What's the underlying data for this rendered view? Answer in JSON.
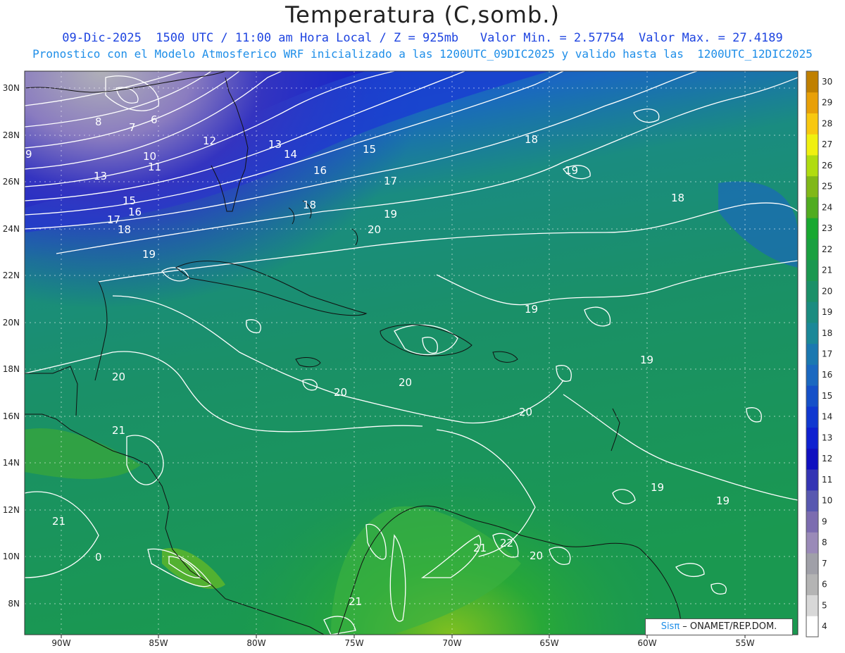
{
  "title": "Temperatura (C,somb.)",
  "subtitle_line1": "09-Dic-2025  1500 UTC / 11:00 am Hora Local / Z = 925mb   Valor Min. = 2.57754  Valor Max. = 27.4189",
  "subtitle_line2": "Pronostico con el Modelo Atmosferico WRF inicializado a las 1200UTC_09DIC2025 y valido hasta las  1200UTC_12DIC2025",
  "map": {
    "lon_labels": [
      "90W",
      "85W",
      "80W",
      "75W",
      "70W",
      "65W",
      "60W",
      "55W"
    ],
    "lat_labels": [
      "30N",
      "28N",
      "26N",
      "24N",
      "22N",
      "20N",
      "18N",
      "16N",
      "14N",
      "12N",
      "10N",
      "8N"
    ],
    "contour_labels": [
      "9",
      "8",
      "7",
      "6",
      "10",
      "11",
      "12",
      "13",
      "13",
      "14",
      "15",
      "16",
      "15",
      "16",
      "17",
      "17",
      "18",
      "18",
      "18",
      "19",
      "19",
      "19",
      "20",
      "19",
      "19",
      "20",
      "20",
      "20",
      "20",
      "21",
      "21",
      "21",
      "22",
      "21",
      "20",
      "19",
      "19",
      "0",
      "18"
    ]
  },
  "colorbar": {
    "ticks": [
      "4",
      "5",
      "6",
      "7",
      "8",
      "9",
      "10",
      "11",
      "12",
      "13",
      "14",
      "15",
      "16",
      "17",
      "18",
      "19",
      "20",
      "21",
      "22",
      "23",
      "24",
      "25",
      "26",
      "27",
      "28",
      "29",
      "30"
    ],
    "colors": [
      "#ffffff",
      "#d8d8d8",
      "#b4b4b4",
      "#a0a0a8",
      "#9a8ab8",
      "#7c6cb0",
      "#5858b0",
      "#3434b4",
      "#1010c0",
      "#0e20d0",
      "#1038d0",
      "#1550c8",
      "#1a68c0",
      "#1a78b0",
      "#1a8898",
      "#1a8c80",
      "#1a9068",
      "#1a9850",
      "#1aa040",
      "#18a830",
      "#50ac20",
      "#80b818",
      "#b0dc10",
      "#f0f010",
      "#f8c810",
      "#e8a008",
      "#c08000"
    ]
  },
  "badge": {
    "brand": "Sisπ",
    "org": " –  ONAMET/REP.DOM."
  }
}
